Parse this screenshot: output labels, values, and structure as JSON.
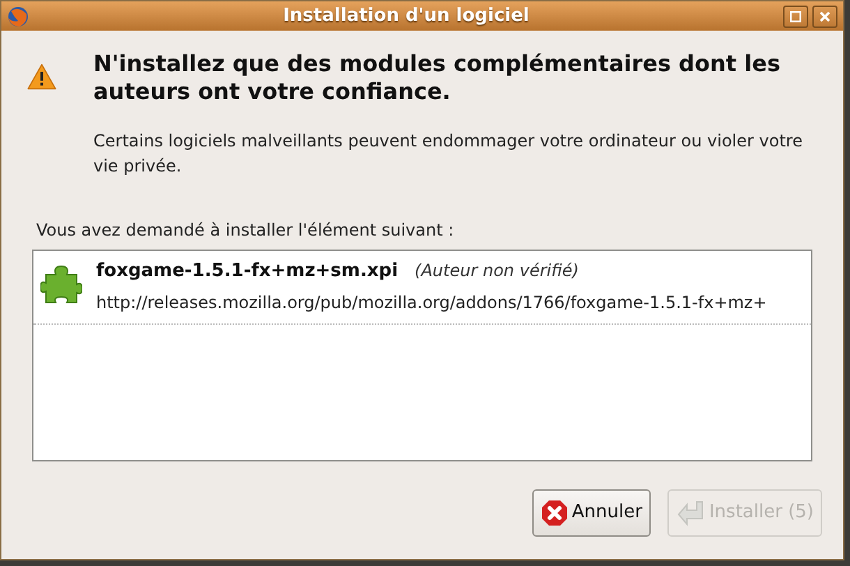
{
  "window": {
    "title": "Installation d'un logiciel"
  },
  "warning": {
    "heading": "N'installez que des modules complémentaires dont les auteurs ont votre confiance.",
    "message": "Certains logiciels malveillants peuvent endommager votre ordinateur ou violer votre vie privée."
  },
  "list_label": "Vous avez demandé à installer l'élément suivant :",
  "items": [
    {
      "name": "foxgame-1.5.1-fx+mz+sm.xpi",
      "author_note": "(Auteur non vérifié)",
      "url": "http://releases.mozilla.org/pub/mozilla.org/addons/1766/foxgame-1.5.1-fx+mz+",
      "selected": false
    }
  ],
  "buttons": [
    {
      "kind": "cancel",
      "label": "Annuler",
      "disabled": false
    },
    {
      "kind": "install",
      "label": "Installer (5)",
      "disabled": true
    }
  ]
}
